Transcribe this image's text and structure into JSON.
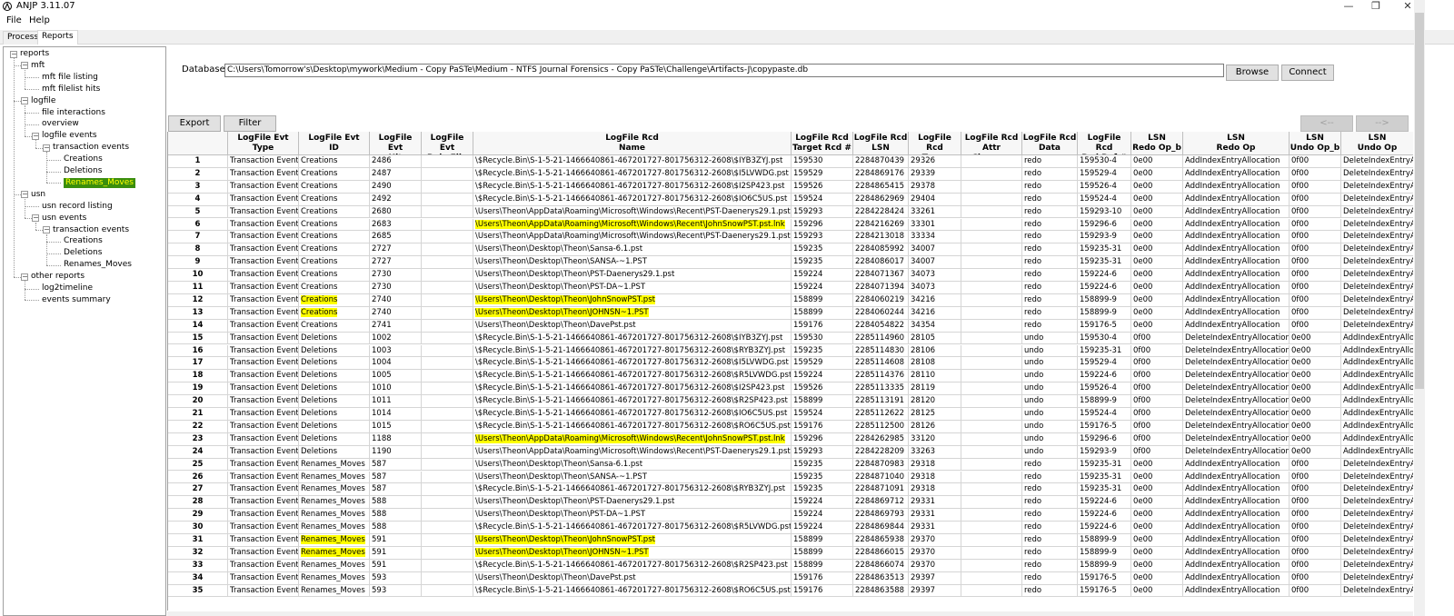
{
  "app": {
    "title": "ANJP 3.11.07"
  },
  "window": {
    "minimize": "—",
    "maximize": "❐",
    "close": "✕"
  },
  "menu": [
    "File",
    "Help"
  ],
  "tabs": [
    "Process",
    "Reports"
  ],
  "tree": [
    {
      "label": "reports",
      "level": 0,
      "box": "−"
    },
    {
      "label": "mft",
      "level": 1,
      "box": "−"
    },
    {
      "label": "mft file listing",
      "level": 2
    },
    {
      "label": "mft filelist hits",
      "level": 2
    },
    {
      "label": "logfile",
      "level": 1,
      "box": "−"
    },
    {
      "label": "file interactions",
      "level": 2
    },
    {
      "label": "overview",
      "level": 2
    },
    {
      "label": "logfile events",
      "level": 2,
      "box": "−"
    },
    {
      "label": "transaction events",
      "level": 3,
      "box": "−"
    },
    {
      "label": "Creations",
      "level": 4
    },
    {
      "label": "Deletions",
      "level": 4
    },
    {
      "label": "Renames_Moves",
      "level": 4,
      "selected": true
    },
    {
      "label": "usn",
      "level": 1,
      "box": "−"
    },
    {
      "label": "usn record listing",
      "level": 2
    },
    {
      "label": "usn events",
      "level": 2,
      "box": "−"
    },
    {
      "label": "transaction events",
      "level": 3,
      "box": "−"
    },
    {
      "label": "Creations",
      "level": 4
    },
    {
      "label": "Deletions",
      "level": 4
    },
    {
      "label": "Renames_Moves",
      "level": 4
    },
    {
      "label": "other reports",
      "level": 1,
      "box": "−"
    },
    {
      "label": "log2timeline",
      "level": 2
    },
    {
      "label": "events summary",
      "level": 2
    }
  ],
  "db": {
    "label": "Database:",
    "path": "C:\\Users\\Tomorrow's\\Desktop\\mywork\\Medium - Copy PaSTe\\Medium - NTFS Journal Forensics - Copy PaSTe\\Challenge\\Artifacts-J\\copypaste.db",
    "browse": "Browse",
    "connect": "Connect"
  },
  "toolbar": {
    "export": "Export",
    "filter": "Filter",
    "prev": "<--",
    "next": "-->"
  },
  "columns": [
    "",
    "LogFile Evt\nType",
    "LogFile Evt\nID",
    "LogFile Evt\nHit",
    "LogFile Evt\nRule File",
    "LogFile Rcd\nName",
    "LogFile Rcd\nTarget Rcd #",
    "LogFile Rcd\nLSN",
    "LogFile Rcd\nTrans",
    "LogFile Rcd\nAttr Changes",
    "LogFile Rcd\nData",
    "LogFile Rcd\nRcd Ref #",
    "LSN\nRedo Op_b",
    "LSN\nRedo Op",
    "LSN\nUndo Op_b",
    "LSN\nUndo Op"
  ],
  "rows": [
    [
      "1",
      "Transaction Event",
      "Creations",
      "2486",
      "",
      "\\$Recycle.Bin\\S-1-5-21-1466640861-467201727-801756312-2608\\$IYB3ZYJ.pst",
      "159530",
      "2284870439",
      "29326",
      "",
      "redo",
      "159530-4",
      "0e00",
      "AddIndexEntryAllocation",
      "0f00",
      "DeleteIndexEntryAllocation"
    ],
    [
      "2",
      "Transaction Event",
      "Creations",
      "2487",
      "",
      "\\$Recycle.Bin\\S-1-5-21-1466640861-467201727-801756312-2608\\$I5LVWDG.pst",
      "159529",
      "2284869176",
      "29339",
      "",
      "redo",
      "159529-4",
      "0e00",
      "AddIndexEntryAllocation",
      "0f00",
      "DeleteIndexEntryAllocation"
    ],
    [
      "3",
      "Transaction Event",
      "Creations",
      "2490",
      "",
      "\\$Recycle.Bin\\S-1-5-21-1466640861-467201727-801756312-2608\\$I2SP423.pst",
      "159526",
      "2284865415",
      "29378",
      "",
      "redo",
      "159526-4",
      "0e00",
      "AddIndexEntryAllocation",
      "0f00",
      "DeleteIndexEntryAllocation"
    ],
    [
      "4",
      "Transaction Event",
      "Creations",
      "2492",
      "",
      "\\$Recycle.Bin\\S-1-5-21-1466640861-467201727-801756312-2608\\$IO6C5US.pst",
      "159524",
      "2284862969",
      "29404",
      "",
      "redo",
      "159524-4",
      "0e00",
      "AddIndexEntryAllocation",
      "0f00",
      "DeleteIndexEntryAllocation"
    ],
    [
      "5",
      "Transaction Event",
      "Creations",
      "2680",
      "",
      "\\Users\\Theon\\AppData\\Roaming\\Microsoft\\Windows\\Recent\\PST-Daenerys29.1.pst.lnk",
      "159293",
      "2284228424",
      "33261",
      "",
      "redo",
      "159293-10",
      "0e00",
      "AddIndexEntryAllocation",
      "0f00",
      "DeleteIndexEntryAllocation"
    ],
    [
      "6",
      "Transaction Event",
      "Creations",
      "2683",
      "",
      "\\Users\\Theon\\AppData\\Roaming\\Microsoft\\Windows\\Recent\\JohnSnowPST.pst.lnk",
      "159296",
      "2284216269",
      "33301",
      "",
      "redo",
      "159296-6",
      "0e00",
      "AddIndexEntryAllocation",
      "0f00",
      "DeleteIndexEntryAllocation"
    ],
    [
      "7",
      "Transaction Event",
      "Creations",
      "2685",
      "",
      "\\Users\\Theon\\AppData\\Roaming\\Microsoft\\Windows\\Recent\\PST-Daenerys29.1.pst.lnk",
      "159293",
      "2284213018",
      "33334",
      "",
      "redo",
      "159293-9",
      "0e00",
      "AddIndexEntryAllocation",
      "0f00",
      "DeleteIndexEntryAllocation"
    ],
    [
      "8",
      "Transaction Event",
      "Creations",
      "2727",
      "",
      "\\Users\\Theon\\Desktop\\Theon\\Sansa-6.1.pst",
      "159235",
      "2284085992",
      "34007",
      "",
      "redo",
      "159235-31",
      "0e00",
      "AddIndexEntryAllocation",
      "0f00",
      "DeleteIndexEntryAllocation"
    ],
    [
      "9",
      "Transaction Event",
      "Creations",
      "2727",
      "",
      "\\Users\\Theon\\Desktop\\Theon\\SANSA-~1.PST",
      "159235",
      "2284086017",
      "34007",
      "",
      "redo",
      "159235-31",
      "0e00",
      "AddIndexEntryAllocation",
      "0f00",
      "DeleteIndexEntryAllocation"
    ],
    [
      "10",
      "Transaction Event",
      "Creations",
      "2730",
      "",
      "\\Users\\Theon\\Desktop\\Theon\\PST-Daenerys29.1.pst",
      "159224",
      "2284071367",
      "34073",
      "",
      "redo",
      "159224-6",
      "0e00",
      "AddIndexEntryAllocation",
      "0f00",
      "DeleteIndexEntryAllocation"
    ],
    [
      "11",
      "Transaction Event",
      "Creations",
      "2730",
      "",
      "\\Users\\Theon\\Desktop\\Theon\\PST-DA~1.PST",
      "159224",
      "2284071394",
      "34073",
      "",
      "redo",
      "159224-6",
      "0e00",
      "AddIndexEntryAllocation",
      "0f00",
      "DeleteIndexEntryAllocation"
    ],
    [
      "12",
      "Transaction Event",
      "Creations",
      "2740",
      "",
      "\\Users\\Theon\\Desktop\\Theon\\JohnSnowPST.pst",
      "158899",
      "2284060219",
      "34216",
      "",
      "redo",
      "158899-9",
      "0e00",
      "AddIndexEntryAllocation",
      "0f00",
      "DeleteIndexEntryAllocation"
    ],
    [
      "13",
      "Transaction Event",
      "Creations",
      "2740",
      "",
      "\\Users\\Theon\\Desktop\\Theon\\JOHNSN~1.PST",
      "158899",
      "2284060244",
      "34216",
      "",
      "redo",
      "158899-9",
      "0e00",
      "AddIndexEntryAllocation",
      "0f00",
      "DeleteIndexEntryAllocation"
    ],
    [
      "14",
      "Transaction Event",
      "Creations",
      "2741",
      "",
      "\\Users\\Theon\\Desktop\\Theon\\DavePst.pst",
      "159176",
      "2284054822",
      "34354",
      "",
      "redo",
      "159176-5",
      "0e00",
      "AddIndexEntryAllocation",
      "0f00",
      "DeleteIndexEntryAllocation"
    ],
    [
      "15",
      "Transaction Event",
      "Deletions",
      "1002",
      "",
      "\\$Recycle.Bin\\S-1-5-21-1466640861-467201727-801756312-2608\\$IYB3ZYJ.pst",
      "159530",
      "2285114960",
      "28105",
      "",
      "undo",
      "159530-4",
      "0f00",
      "DeleteIndexEntryAllocation",
      "0e00",
      "AddIndexEntryAllocation"
    ],
    [
      "16",
      "Transaction Event",
      "Deletions",
      "1003",
      "",
      "\\$Recycle.Bin\\S-1-5-21-1466640861-467201727-801756312-2608\\$RYB3ZYJ.pst",
      "159235",
      "2285114830",
      "28106",
      "",
      "undo",
      "159235-31",
      "0f00",
      "DeleteIndexEntryAllocation",
      "0e00",
      "AddIndexEntryAllocation"
    ],
    [
      "17",
      "Transaction Event",
      "Deletions",
      "1004",
      "",
      "\\$Recycle.Bin\\S-1-5-21-1466640861-467201727-801756312-2608\\$I5LVWDG.pst",
      "159529",
      "2285114608",
      "28108",
      "",
      "undo",
      "159529-4",
      "0f00",
      "DeleteIndexEntryAllocation",
      "0e00",
      "AddIndexEntryAllocation"
    ],
    [
      "18",
      "Transaction Event",
      "Deletions",
      "1005",
      "",
      "\\$Recycle.Bin\\S-1-5-21-1466640861-467201727-801756312-2608\\$R5LVWDG.pst",
      "159224",
      "2285114376",
      "28110",
      "",
      "undo",
      "159224-6",
      "0f00",
      "DeleteIndexEntryAllocation",
      "0e00",
      "AddIndexEntryAllocation"
    ],
    [
      "19",
      "Transaction Event",
      "Deletions",
      "1010",
      "",
      "\\$Recycle.Bin\\S-1-5-21-1466640861-467201727-801756312-2608\\$I2SP423.pst",
      "159526",
      "2285113335",
      "28119",
      "",
      "undo",
      "159526-4",
      "0f00",
      "DeleteIndexEntryAllocation",
      "0e00",
      "AddIndexEntryAllocation"
    ],
    [
      "20",
      "Transaction Event",
      "Deletions",
      "1011",
      "",
      "\\$Recycle.Bin\\S-1-5-21-1466640861-467201727-801756312-2608\\$R2SP423.pst",
      "158899",
      "2285113191",
      "28120",
      "",
      "undo",
      "158899-9",
      "0f00",
      "DeleteIndexEntryAllocation",
      "0e00",
      "AddIndexEntryAllocation"
    ],
    [
      "21",
      "Transaction Event",
      "Deletions",
      "1014",
      "",
      "\\$Recycle.Bin\\S-1-5-21-1466640861-467201727-801756312-2608\\$IO6C5US.pst",
      "159524",
      "2285112622",
      "28125",
      "",
      "undo",
      "159524-4",
      "0f00",
      "DeleteIndexEntryAllocation",
      "0e00",
      "AddIndexEntryAllocation"
    ],
    [
      "22",
      "Transaction Event",
      "Deletions",
      "1015",
      "",
      "\\$Recycle.Bin\\S-1-5-21-1466640861-467201727-801756312-2608\\$RO6C5US.pst",
      "159176",
      "2285112500",
      "28126",
      "",
      "undo",
      "159176-5",
      "0f00",
      "DeleteIndexEntryAllocation",
      "0e00",
      "AddIndexEntryAllocation"
    ],
    [
      "23",
      "Transaction Event",
      "Deletions",
      "1188",
      "",
      "\\Users\\Theon\\AppData\\Roaming\\Microsoft\\Windows\\Recent\\JohnSnowPST.pst.lnk",
      "159296",
      "2284262985",
      "33120",
      "",
      "undo",
      "159296-6",
      "0f00",
      "DeleteIndexEntryAllocation",
      "0e00",
      "AddIndexEntryAllocation"
    ],
    [
      "24",
      "Transaction Event",
      "Deletions",
      "1190",
      "",
      "\\Users\\Theon\\AppData\\Roaming\\Microsoft\\Windows\\Recent\\PST-Daenerys29.1.pst.lnk",
      "159293",
      "2284228209",
      "33263",
      "",
      "undo",
      "159293-9",
      "0f00",
      "DeleteIndexEntryAllocation",
      "0e00",
      "AddIndexEntryAllocation"
    ],
    [
      "25",
      "Transaction Event",
      "Renames_Moves",
      "587",
      "",
      "\\Users\\Theon\\Desktop\\Theon\\Sansa-6.1.pst",
      "159235",
      "2284870983",
      "29318",
      "",
      "redo",
      "159235-31",
      "0e00",
      "AddIndexEntryAllocation",
      "0f00",
      "DeleteIndexEntryAllocation"
    ],
    [
      "26",
      "Transaction Event",
      "Renames_Moves",
      "587",
      "",
      "\\Users\\Theon\\Desktop\\Theon\\SANSA-~1.PST",
      "159235",
      "2284871040",
      "29318",
      "",
      "redo",
      "159235-31",
      "0e00",
      "AddIndexEntryAllocation",
      "0f00",
      "DeleteIndexEntryAllocation"
    ],
    [
      "27",
      "Transaction Event",
      "Renames_Moves",
      "587",
      "",
      "\\$Recycle.Bin\\S-1-5-21-1466640861-467201727-801756312-2608\\$RYB3ZYJ.pst",
      "159235",
      "2284871091",
      "29318",
      "",
      "redo",
      "159235-31",
      "0e00",
      "AddIndexEntryAllocation",
      "0f00",
      "DeleteIndexEntryAllocation"
    ],
    [
      "28",
      "Transaction Event",
      "Renames_Moves",
      "588",
      "",
      "\\Users\\Theon\\Desktop\\Theon\\PST-Daenerys29.1.pst",
      "159224",
      "2284869712",
      "29331",
      "",
      "redo",
      "159224-6",
      "0e00",
      "AddIndexEntryAllocation",
      "0f00",
      "DeleteIndexEntryAllocation"
    ],
    [
      "29",
      "Transaction Event",
      "Renames_Moves",
      "588",
      "",
      "\\Users\\Theon\\Desktop\\Theon\\PST-DA~1.PST",
      "159224",
      "2284869793",
      "29331",
      "",
      "redo",
      "159224-6",
      "0e00",
      "AddIndexEntryAllocation",
      "0f00",
      "DeleteIndexEntryAllocation"
    ],
    [
      "30",
      "Transaction Event",
      "Renames_Moves",
      "588",
      "",
      "\\$Recycle.Bin\\S-1-5-21-1466640861-467201727-801756312-2608\\$R5LVWDG.pst",
      "159224",
      "2284869844",
      "29331",
      "",
      "redo",
      "159224-6",
      "0e00",
      "AddIndexEntryAllocation",
      "0f00",
      "DeleteIndexEntryAllocation"
    ],
    [
      "31",
      "Transaction Event",
      "Renames_Moves",
      "591",
      "",
      "\\Users\\Theon\\Desktop\\Theon\\JohnSnowPST.pst",
      "158899",
      "2284865938",
      "29370",
      "",
      "redo",
      "158899-9",
      "0e00",
      "AddIndexEntryAllocation",
      "0f00",
      "DeleteIndexEntryAllocation"
    ],
    [
      "32",
      "Transaction Event",
      "Renames_Moves",
      "591",
      "",
      "\\Users\\Theon\\Desktop\\Theon\\JOHNSN~1.PST",
      "158899",
      "2284866015",
      "29370",
      "",
      "redo",
      "158899-9",
      "0e00",
      "AddIndexEntryAllocation",
      "0f00",
      "DeleteIndexEntryAllocation"
    ],
    [
      "33",
      "Transaction Event",
      "Renames_Moves",
      "591",
      "",
      "\\$Recycle.Bin\\S-1-5-21-1466640861-467201727-801756312-2608\\$R2SP423.pst",
      "158899",
      "2284866074",
      "29370",
      "",
      "redo",
      "158899-9",
      "0e00",
      "AddIndexEntryAllocation",
      "0f00",
      "DeleteIndexEntryAllocation"
    ],
    [
      "34",
      "Transaction Event",
      "Renames_Moves",
      "593",
      "",
      "\\Users\\Theon\\Desktop\\Theon\\DavePst.pst",
      "159176",
      "2284863513",
      "29397",
      "",
      "redo",
      "159176-5",
      "0e00",
      "AddIndexEntryAllocation",
      "0f00",
      "DeleteIndexEntryAllocation"
    ],
    [
      "35",
      "Transaction Event",
      "Renames_Moves",
      "593",
      "",
      "\\$Recycle.Bin\\S-1-5-21-1466640861-467201727-801756312-2608\\$RO6C5US.pst",
      "159176",
      "2284863588",
      "29397",
      "",
      "redo",
      "159176-5",
      "0e00",
      "AddIndexEntryAllocation",
      "0f00",
      "DeleteIndexEntryAllocation"
    ]
  ],
  "highlights": {
    "6": [
      5
    ],
    "12": [
      2,
      5
    ],
    "13": [
      2,
      5
    ],
    "23": [
      5
    ],
    "31": [
      2,
      5
    ],
    "32": [
      2,
      5
    ]
  },
  "colors": {
    "highlight": "#ffff00",
    "selected_bg": "#3a8e0c",
    "selected_fg": "#ffff00"
  }
}
